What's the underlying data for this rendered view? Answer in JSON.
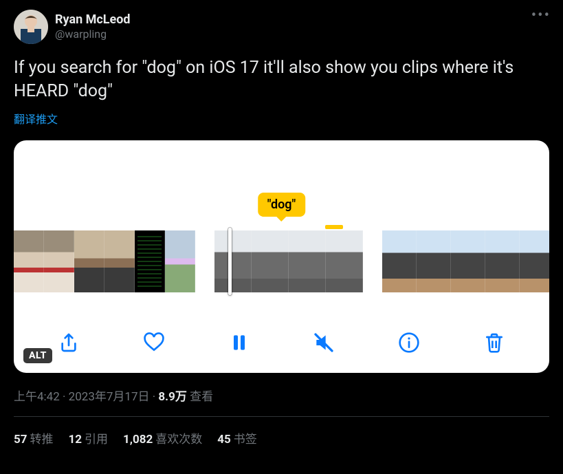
{
  "user": {
    "display_name": "Ryan McLeod",
    "handle": "@warpling"
  },
  "tweet": {
    "text": "If you search for \"dog\" on iOS 17 it'll also show you clips where it's HEARD \"dog\"",
    "translate_label": "翻译推文"
  },
  "media": {
    "tooltip_label": "\"dog\"",
    "alt_badge": "ALT"
  },
  "meta": {
    "time": "上午4:42",
    "sep": " · ",
    "date": "2023年7月17日",
    "views_count": "8.9万",
    "views_label": " 查看"
  },
  "stats": {
    "retweets_count": "57",
    "retweets_label": "转推",
    "quotes_count": "12",
    "quotes_label": "引用",
    "likes_count": "1,082",
    "likes_label": "喜欢次数",
    "bookmarks_count": "45",
    "bookmarks_label": "书签"
  }
}
